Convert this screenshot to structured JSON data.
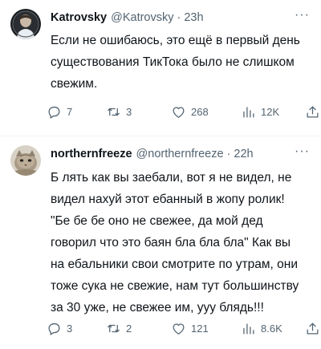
{
  "tweets": [
    {
      "author_name": "Katrovsky",
      "handle": "@Katrovsky",
      "separator": "·",
      "time": "23h",
      "more_label": "···",
      "text": "Если не ошибаюсь, это ещё в первый день\nсуществования ТикТока было не слишком\nсвежим.",
      "replies": "7",
      "retweets": "3",
      "likes": "268",
      "views": "12K"
    },
    {
      "author_name": "northernfreeze",
      "handle": "@northernfreeze",
      "separator": "·",
      "time": "22h",
      "more_label": "···",
      "text": "Б лять как вы заебали, вот я не видел, не\nвидел нахуй этот ебанный в жопу ролик!\n\"Бе бе бе оно не свежее, да мой дед\nговорил что это баян бла бла бла\" Как вы\nна ебальники свои смотрите по утрам, они\nтоже сука не свежие, нам тут большинству\nза 30 уже, не свежее им, ууу блядь!!!",
      "replies": "3",
      "retweets": "2",
      "likes": "121",
      "views": "8.6K"
    }
  ],
  "colors": {
    "text": "#0f1419",
    "muted": "#536471",
    "divider": "#eff3f4"
  },
  "icons": [
    "reply-icon",
    "retweet-icon",
    "like-icon",
    "views-icon",
    "share-icon",
    "more-icon"
  ]
}
